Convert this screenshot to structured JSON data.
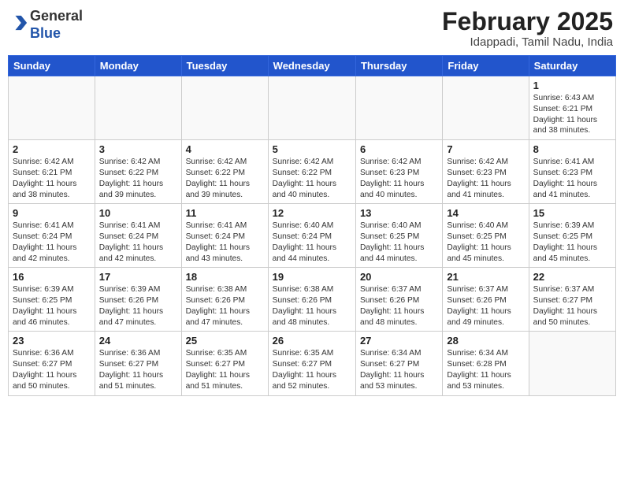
{
  "header": {
    "logo_general": "General",
    "logo_blue": "Blue",
    "month_title": "February 2025",
    "location": "Idappadi, Tamil Nadu, India"
  },
  "days_of_week": [
    "Sunday",
    "Monday",
    "Tuesday",
    "Wednesday",
    "Thursday",
    "Friday",
    "Saturday"
  ],
  "weeks": [
    [
      {
        "day": "",
        "info": ""
      },
      {
        "day": "",
        "info": ""
      },
      {
        "day": "",
        "info": ""
      },
      {
        "day": "",
        "info": ""
      },
      {
        "day": "",
        "info": ""
      },
      {
        "day": "",
        "info": ""
      },
      {
        "day": "1",
        "info": "Sunrise: 6:43 AM\nSunset: 6:21 PM\nDaylight: 11 hours\nand 38 minutes."
      }
    ],
    [
      {
        "day": "2",
        "info": "Sunrise: 6:42 AM\nSunset: 6:21 PM\nDaylight: 11 hours\nand 38 minutes."
      },
      {
        "day": "3",
        "info": "Sunrise: 6:42 AM\nSunset: 6:22 PM\nDaylight: 11 hours\nand 39 minutes."
      },
      {
        "day": "4",
        "info": "Sunrise: 6:42 AM\nSunset: 6:22 PM\nDaylight: 11 hours\nand 39 minutes."
      },
      {
        "day": "5",
        "info": "Sunrise: 6:42 AM\nSunset: 6:22 PM\nDaylight: 11 hours\nand 40 minutes."
      },
      {
        "day": "6",
        "info": "Sunrise: 6:42 AM\nSunset: 6:23 PM\nDaylight: 11 hours\nand 40 minutes."
      },
      {
        "day": "7",
        "info": "Sunrise: 6:42 AM\nSunset: 6:23 PM\nDaylight: 11 hours\nand 41 minutes."
      },
      {
        "day": "8",
        "info": "Sunrise: 6:41 AM\nSunset: 6:23 PM\nDaylight: 11 hours\nand 41 minutes."
      }
    ],
    [
      {
        "day": "9",
        "info": "Sunrise: 6:41 AM\nSunset: 6:24 PM\nDaylight: 11 hours\nand 42 minutes."
      },
      {
        "day": "10",
        "info": "Sunrise: 6:41 AM\nSunset: 6:24 PM\nDaylight: 11 hours\nand 42 minutes."
      },
      {
        "day": "11",
        "info": "Sunrise: 6:41 AM\nSunset: 6:24 PM\nDaylight: 11 hours\nand 43 minutes."
      },
      {
        "day": "12",
        "info": "Sunrise: 6:40 AM\nSunset: 6:24 PM\nDaylight: 11 hours\nand 44 minutes."
      },
      {
        "day": "13",
        "info": "Sunrise: 6:40 AM\nSunset: 6:25 PM\nDaylight: 11 hours\nand 44 minutes."
      },
      {
        "day": "14",
        "info": "Sunrise: 6:40 AM\nSunset: 6:25 PM\nDaylight: 11 hours\nand 45 minutes."
      },
      {
        "day": "15",
        "info": "Sunrise: 6:39 AM\nSunset: 6:25 PM\nDaylight: 11 hours\nand 45 minutes."
      }
    ],
    [
      {
        "day": "16",
        "info": "Sunrise: 6:39 AM\nSunset: 6:25 PM\nDaylight: 11 hours\nand 46 minutes."
      },
      {
        "day": "17",
        "info": "Sunrise: 6:39 AM\nSunset: 6:26 PM\nDaylight: 11 hours\nand 47 minutes."
      },
      {
        "day": "18",
        "info": "Sunrise: 6:38 AM\nSunset: 6:26 PM\nDaylight: 11 hours\nand 47 minutes."
      },
      {
        "day": "19",
        "info": "Sunrise: 6:38 AM\nSunset: 6:26 PM\nDaylight: 11 hours\nand 48 minutes."
      },
      {
        "day": "20",
        "info": "Sunrise: 6:37 AM\nSunset: 6:26 PM\nDaylight: 11 hours\nand 48 minutes."
      },
      {
        "day": "21",
        "info": "Sunrise: 6:37 AM\nSunset: 6:26 PM\nDaylight: 11 hours\nand 49 minutes."
      },
      {
        "day": "22",
        "info": "Sunrise: 6:37 AM\nSunset: 6:27 PM\nDaylight: 11 hours\nand 50 minutes."
      }
    ],
    [
      {
        "day": "23",
        "info": "Sunrise: 6:36 AM\nSunset: 6:27 PM\nDaylight: 11 hours\nand 50 minutes."
      },
      {
        "day": "24",
        "info": "Sunrise: 6:36 AM\nSunset: 6:27 PM\nDaylight: 11 hours\nand 51 minutes."
      },
      {
        "day": "25",
        "info": "Sunrise: 6:35 AM\nSunset: 6:27 PM\nDaylight: 11 hours\nand 51 minutes."
      },
      {
        "day": "26",
        "info": "Sunrise: 6:35 AM\nSunset: 6:27 PM\nDaylight: 11 hours\nand 52 minutes."
      },
      {
        "day": "27",
        "info": "Sunrise: 6:34 AM\nSunset: 6:27 PM\nDaylight: 11 hours\nand 53 minutes."
      },
      {
        "day": "28",
        "info": "Sunrise: 6:34 AM\nSunset: 6:28 PM\nDaylight: 11 hours\nand 53 minutes."
      },
      {
        "day": "",
        "info": ""
      }
    ]
  ]
}
